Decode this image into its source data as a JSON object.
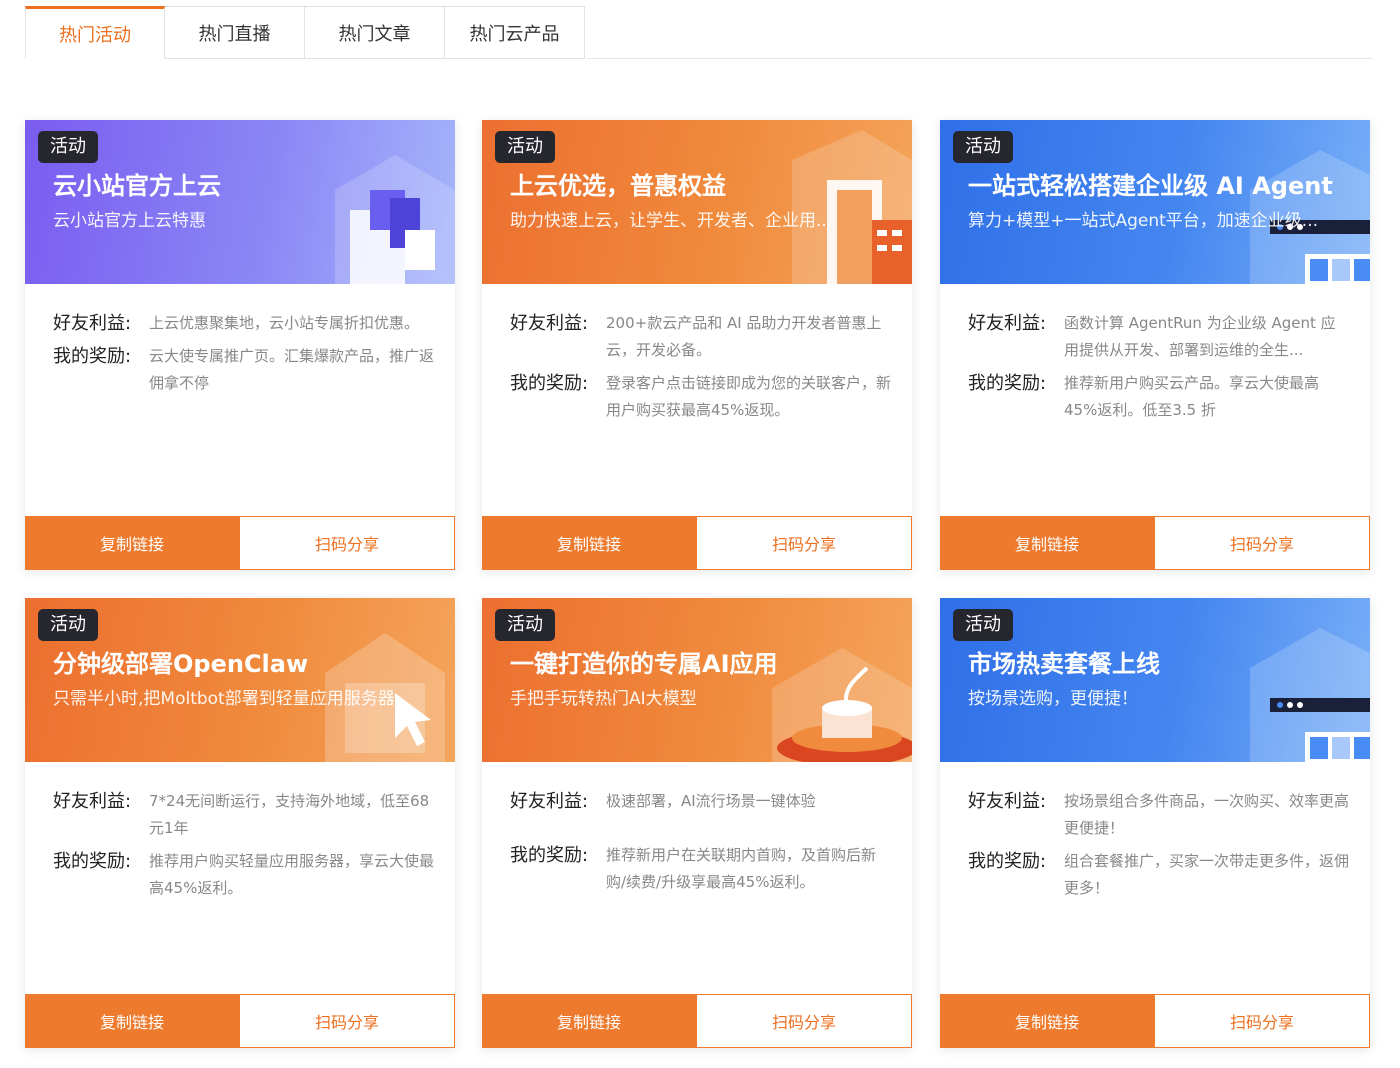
{
  "tabs": [
    {
      "label": "热门活动",
      "active": true
    },
    {
      "label": "热门直播",
      "active": false
    },
    {
      "label": "热门文章",
      "active": false
    },
    {
      "label": "热门云产品",
      "active": false
    }
  ],
  "colors": {
    "accent": "#ee6f1e",
    "tag_bg": "#25262e"
  },
  "friend_label": "好友利益:",
  "reward_label": "我的奖励:",
  "copy_label": "复制链接",
  "share_label": "扫码分享",
  "cards": [
    {
      "tag": "活动",
      "title": "云小站官方上云",
      "subtitle": "云小站官方上云特惠",
      "friend": "上云优惠聚集地，云小站专属折扣优惠。",
      "reward": "云大使专属推广页。汇集爆款产品，推广返佣拿不停",
      "icon": "cube-tower-illustration"
    },
    {
      "tag": "活动",
      "title": "上云优选，普惠权益",
      "subtitle": "助力快速上云，让学生、开发者、企业用...",
      "friend": "200+款云产品和 AI 品助力开发者普惠上云，开发必备。",
      "reward": "登录客户点击链接即成为您的关联客户，新用户购买获最高45%返现。",
      "icon": "building-illustration"
    },
    {
      "tag": "活动",
      "title": "一站式轻松搭建企业级 AI Agent",
      "subtitle": "算力+模型+一站式Agent平台，加速企业级...",
      "friend": "函数计算 AgentRun 为企业级 Agent 应用提供从开发、部署到运维的全生...",
      "reward": "推荐新用户购买云产品。享云大使最高45%返利。低至3.5 折",
      "icon": "browser-window-illustration"
    },
    {
      "tag": "活动",
      "title": "分钟级部署OpenClaw",
      "subtitle": "只需半小时,把Moltbot部署到轻量应用服务器",
      "friend": "7*24无间断运行，支持海外地域，低至68元1年",
      "reward": "推荐用户购买轻量应用服务器，享云大使最高45%返利。",
      "icon": "house-cursor-illustration"
    },
    {
      "tag": "活动",
      "title": "一键打造你的专属AI应用",
      "subtitle": "手把手玩转热门AI大模型",
      "friend": "极速部署，AI流行场景一键体验",
      "reward": "推荐新用户在关联期内首购，及首购后新购/续费/升级享最高45%返利。",
      "icon": "podium-illustration"
    },
    {
      "tag": "活动",
      "title": "市场热卖套餐上线",
      "subtitle": "按场景选购，更便捷！",
      "friend": "按场景组合多件商品，一次购买、效率更高更便捷！",
      "reward": "组合套餐推广，买家一次带走更多件，返佣更多！",
      "icon": "browser-window-illustration"
    }
  ]
}
